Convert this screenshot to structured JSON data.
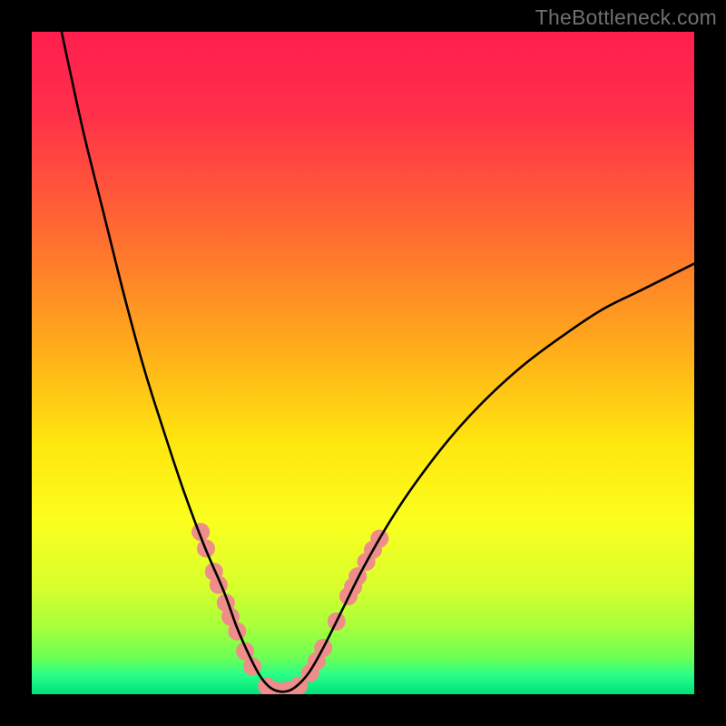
{
  "watermark": "TheBottleneck.com",
  "chart_data": {
    "type": "line",
    "title": "",
    "xlabel": "",
    "ylabel": "",
    "xlim": [
      0,
      100
    ],
    "ylim": [
      0,
      100
    ],
    "gradient_stops": [
      {
        "offset": 0.0,
        "color": "#ff1e4f"
      },
      {
        "offset": 0.12,
        "color": "#ff2f4a"
      },
      {
        "offset": 0.3,
        "color": "#ff6a32"
      },
      {
        "offset": 0.48,
        "color": "#ffad1a"
      },
      {
        "offset": 0.62,
        "color": "#ffe60f"
      },
      {
        "offset": 0.74,
        "color": "#fbff1e"
      },
      {
        "offset": 0.84,
        "color": "#d6ff2d"
      },
      {
        "offset": 0.9,
        "color": "#a6ff3c"
      },
      {
        "offset": 0.945,
        "color": "#6bff55"
      },
      {
        "offset": 0.97,
        "color": "#2aff88"
      },
      {
        "offset": 1.0,
        "color": "#00e27a"
      }
    ],
    "series": [
      {
        "name": "v-curve",
        "stroke": "#000000",
        "points": [
          {
            "x": 4.5,
            "y": 100.0
          },
          {
            "x": 6.0,
            "y": 93.0
          },
          {
            "x": 8.0,
            "y": 84.0
          },
          {
            "x": 11.0,
            "y": 72.0
          },
          {
            "x": 14.0,
            "y": 60.0
          },
          {
            "x": 17.0,
            "y": 49.0
          },
          {
            "x": 20.0,
            "y": 39.5
          },
          {
            "x": 23.0,
            "y": 30.5
          },
          {
            "x": 26.0,
            "y": 22.5
          },
          {
            "x": 29.0,
            "y": 15.5
          },
          {
            "x": 31.0,
            "y": 10.0
          },
          {
            "x": 33.0,
            "y": 5.5
          },
          {
            "x": 34.5,
            "y": 2.7
          },
          {
            "x": 36.0,
            "y": 1.0
          },
          {
            "x": 37.5,
            "y": 0.4
          },
          {
            "x": 39.0,
            "y": 0.6
          },
          {
            "x": 40.5,
            "y": 1.7
          },
          {
            "x": 42.0,
            "y": 3.5
          },
          {
            "x": 44.0,
            "y": 7.0
          },
          {
            "x": 47.0,
            "y": 13.0
          },
          {
            "x": 50.0,
            "y": 19.0
          },
          {
            "x": 54.0,
            "y": 26.0
          },
          {
            "x": 58.0,
            "y": 32.0
          },
          {
            "x": 63.0,
            "y": 38.5
          },
          {
            "x": 68.0,
            "y": 44.0
          },
          {
            "x": 74.0,
            "y": 49.5
          },
          {
            "x": 80.0,
            "y": 54.0
          },
          {
            "x": 86.0,
            "y": 58.0
          },
          {
            "x": 92.0,
            "y": 61.0
          },
          {
            "x": 98.0,
            "y": 64.0
          },
          {
            "x": 100.0,
            "y": 65.0
          }
        ]
      }
    ],
    "markers": {
      "color": "#ee8d8a",
      "radius": 10,
      "points": [
        {
          "x": 25.5,
          "y": 24.5
        },
        {
          "x": 26.3,
          "y": 22.0
        },
        {
          "x": 27.5,
          "y": 18.5
        },
        {
          "x": 28.2,
          "y": 16.5
        },
        {
          "x": 29.3,
          "y": 13.8
        },
        {
          "x": 30.0,
          "y": 11.7
        },
        {
          "x": 31.0,
          "y": 9.5
        },
        {
          "x": 32.2,
          "y": 6.5
        },
        {
          "x": 33.3,
          "y": 4.2
        },
        {
          "x": 35.5,
          "y": 1.2
        },
        {
          "x": 37.2,
          "y": 0.5
        },
        {
          "x": 38.7,
          "y": 0.6
        },
        {
          "x": 40.3,
          "y": 1.3
        },
        {
          "x": 42.0,
          "y": 3.2
        },
        {
          "x": 43.0,
          "y": 5.0
        },
        {
          "x": 44.0,
          "y": 7.0
        },
        {
          "x": 46.0,
          "y": 11.0
        },
        {
          "x": 47.8,
          "y": 14.8
        },
        {
          "x": 48.5,
          "y": 16.2
        },
        {
          "x": 49.2,
          "y": 17.8
        },
        {
          "x": 50.5,
          "y": 20.0
        },
        {
          "x": 51.5,
          "y": 21.8
        },
        {
          "x": 52.5,
          "y": 23.5
        }
      ]
    }
  }
}
